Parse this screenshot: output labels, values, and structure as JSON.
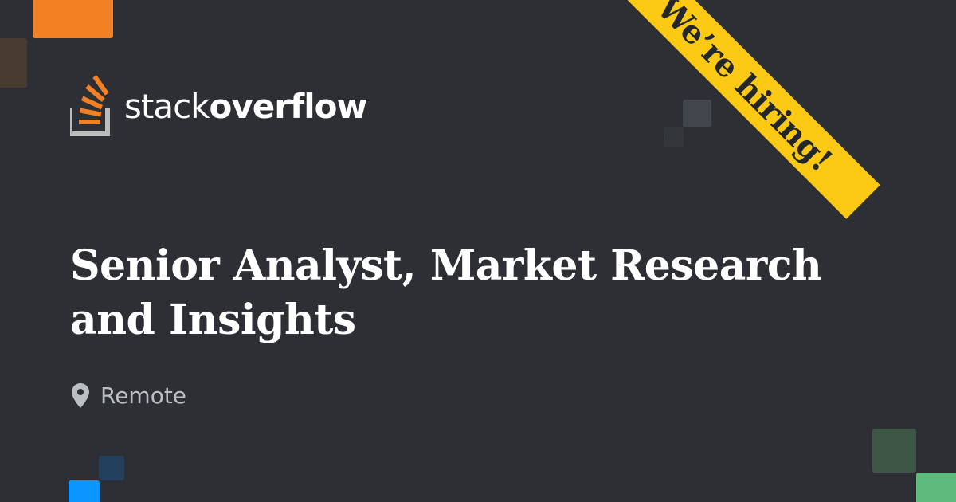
{
  "brand": {
    "name_light": "stack",
    "name_bold": "overflow",
    "logo_icon": "stack-overflow-icon"
  },
  "ribbon": {
    "label": "We’re hiring!"
  },
  "job": {
    "title": "Senior Analyst, Market Research and Insights",
    "location": "Remote",
    "location_icon": "map-pin-icon"
  },
  "colors": {
    "background": "#2d2f34",
    "ribbon": "#fcca14",
    "brand_orange": "#f48024",
    "accent_blue": "#0a95ff",
    "accent_green": "#5eba7d",
    "location_text": "#babfc4"
  }
}
